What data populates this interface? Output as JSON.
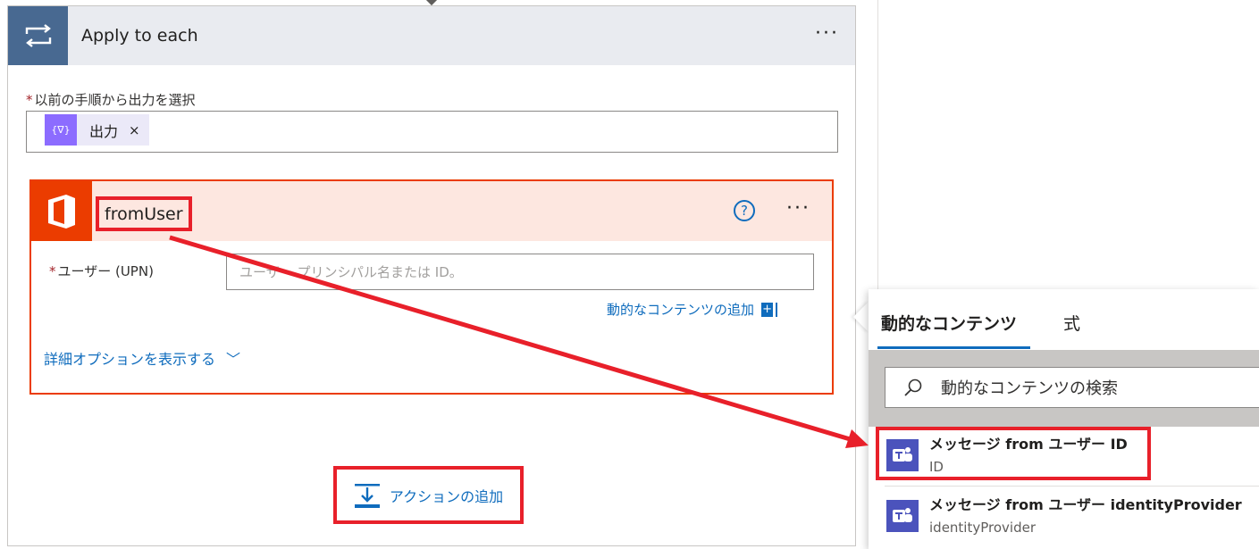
{
  "loop": {
    "title": "Apply to each",
    "more_label": "···",
    "required_star": "*",
    "select_output_label": "以前の手順から出力を選択",
    "token_label": "出力",
    "token_icon_text": "{∇}",
    "token_remove": "×"
  },
  "action": {
    "title": "fromUser",
    "help_label": "?",
    "more_label": "···",
    "required_star": "*",
    "upn_label": "ユーザー (UPN)",
    "upn_placeholder": "ユーザー プリンシパル名または ID。",
    "add_dynamic_label": "動的なコンテンツの追加",
    "add_dynamic_plus": "+",
    "advanced_label": "詳細オプションを表示する",
    "advanced_chevron": "﹀"
  },
  "add_action": {
    "label": "アクションの追加"
  },
  "dynamic_panel": {
    "tab_dynamic": "動的なコンテンツ",
    "tab_expression": "式",
    "search_placeholder": "動的なコンテンツの検索",
    "items": [
      {
        "title": "メッセージ from ユーザー ID",
        "subtitle": "ID"
      },
      {
        "title": "メッセージ from ユーザー identityProvider",
        "subtitle": "identityProvider"
      }
    ]
  },
  "colors": {
    "loop_header_icon": "#486991",
    "office_orange": "#eb3c00",
    "highlight_red": "#e8202a",
    "link_blue": "#0f6cbd",
    "teams_purple": "#4b53bc",
    "token_purple": "#8c6cff"
  },
  "icons": {
    "loop": "loop-arrows-icon",
    "office": "office-logo-icon",
    "add_action": "insert-action-icon",
    "search": "search-icon",
    "teams": "teams-icon"
  }
}
